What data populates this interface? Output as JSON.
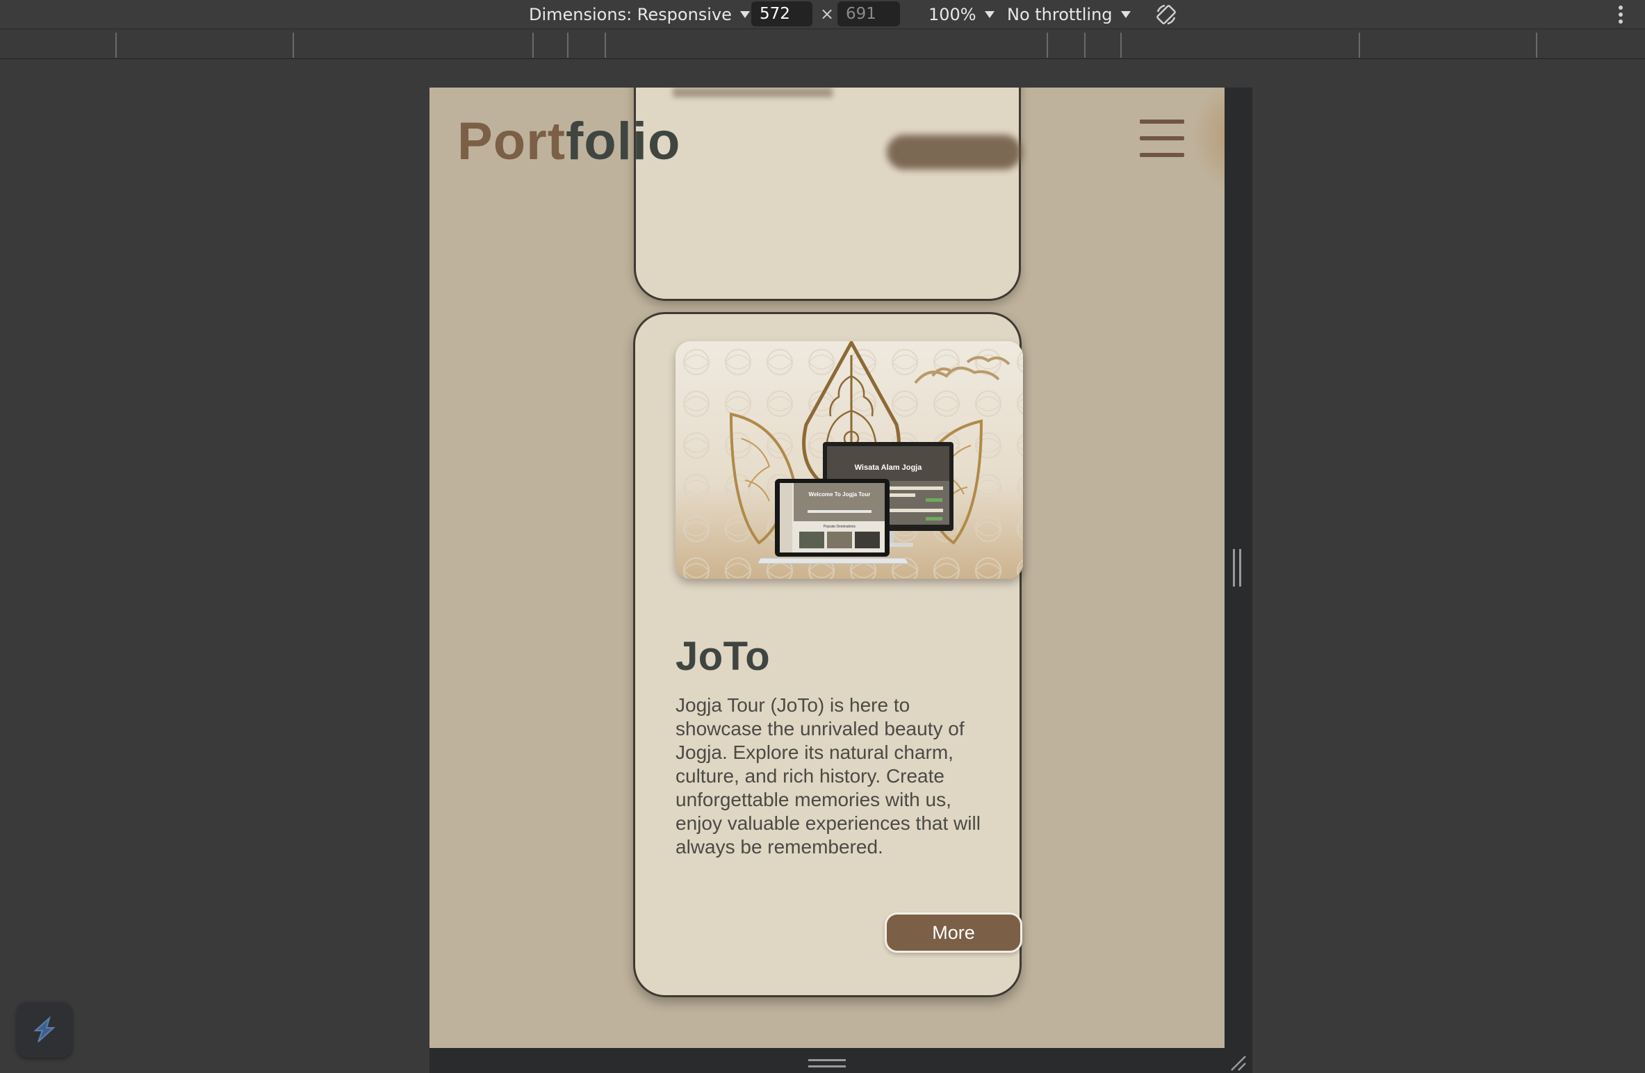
{
  "devtools": {
    "dimensions_label": "Dimensions: Responsive",
    "width_value": "572",
    "times": "×",
    "height_value": "691",
    "zoom": "100%",
    "throttling": "No throttling"
  },
  "page": {
    "logo_part1": "Port",
    "logo_part2": "folio",
    "project": {
      "title": "JoTo",
      "description": "Jogja Tour (JoTo) is here to showcase the unrivaled beauty of Jogja. Explore its natural charm, culture, and rich history. Create unforgettable memories with us, enjoy valuable experiences that will always be remembered.",
      "more_label": "More",
      "image": {
        "monitor_title": "Wisata Alam Jogja",
        "laptop_title": "Welcome To Jogja Tour",
        "laptop_subtitle": "Popular Destinations"
      }
    }
  },
  "colors": {
    "page_bg": "#bfb29c",
    "card_bg": "#e0d6c4",
    "logo_brown": "#7b5f46",
    "logo_dark": "#3f4540",
    "button_bg": "#7b5f46",
    "devtools_bg": "#3c3c3c"
  },
  "icons": [
    "caret-down-icon",
    "rotate-icon",
    "more-vert-icon",
    "hamburger-menu-icon",
    "extension-icon",
    "resize-handle-icon"
  ]
}
